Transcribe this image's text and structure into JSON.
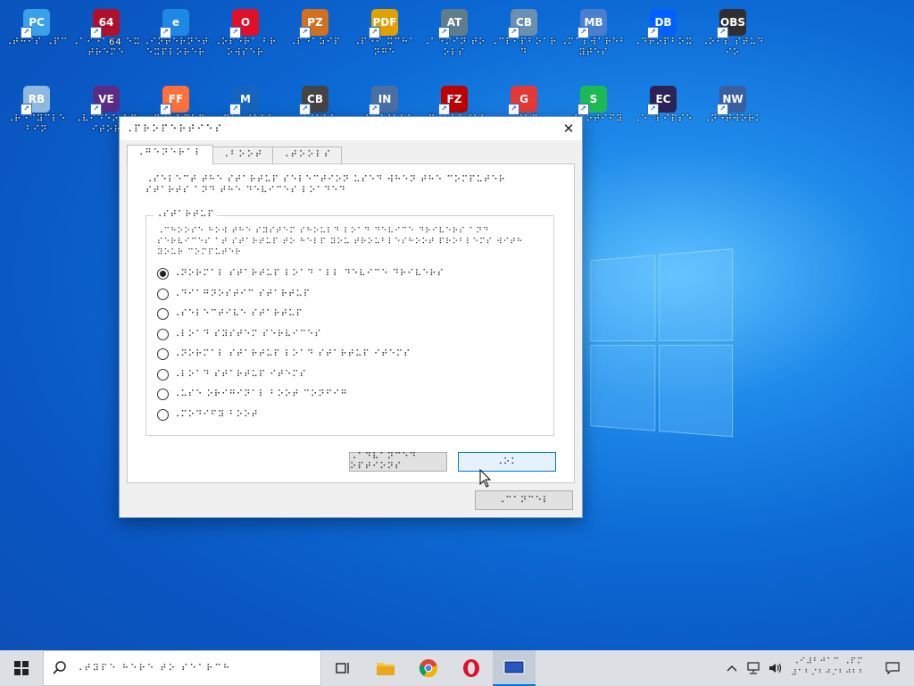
{
  "desktop_icons": [
    {
      "label": "⠠⠞⠓⠊⠎ ⠠⠏⠉",
      "color": "#3aa0e8",
      "glyph": "PC"
    },
    {
      "label": "⠠⠁⠊⠙⠁64 ⠑⠭⠞⠗⠑⠍⠑",
      "color": "#b0102a",
      "glyph": "64"
    },
    {
      "label": "⠠⠊⠝⠞⠑⠗⠝⠑⠞ ⠑⠭⠏⠇⠕⠗⠑⠗",
      "color": "#1e88e5",
      "glyph": "e"
    },
    {
      "label": "⠠⠕⠏⠑⠗⠁ ⠃⠗⠕⠺⠎⠑⠗",
      "color": "#e0102a",
      "glyph": "O"
    },
    {
      "label": "⠠⠏⠑⠁⠵⠊⠏",
      "color": "#d07020",
      "glyph": "PZ"
    },
    {
      "label": "⠠⠏⠙⠋ ⠭⠉⠓⠁⠝⠛⠑",
      "color": "#e0a000",
      "glyph": "PDF"
    },
    {
      "label": "⠠⠁⠙⠍⠊⠝ ⠞⠕⠕⠇⠎",
      "color": "#607d8b",
      "glyph": "AT"
    },
    {
      "label": "⠠⠉⠇⠊⠏⠃⠕⠁⠗⠙",
      "color": "#6a8fb0",
      "glyph": "CB"
    },
    {
      "label": "⠠⠍⠁⠇⠺⠁⠗⠑⠃⠽⠞⠑⠎",
      "color": "#4a7fd0",
      "glyph": "MB"
    },
    {
      "label": "⠠⠙⠗⠕⠏⠃⠕⠭",
      "color": "#0061fe",
      "glyph": "DB"
    },
    {
      "label": "⠠⠕⠃⠎ ⠎⠞⠥⠙⠊⠕",
      "color": "#302e31",
      "glyph": "OBS"
    },
    {
      "label": "⠠⠗⠑⠉⠽⠉⠇⠑ ⠃⠊⠝",
      "color": "#8fb8e0",
      "glyph": "RB"
    },
    {
      "label": "⠠⠧⠊⠙⠑⠕ ⠑⠙⠊⠞⠕⠗",
      "color": "#5b2c86",
      "glyph": "VE"
    },
    {
      "label": "⠠⠋⠊⠗⠑⠋⠕⠭",
      "color": "#ff7139",
      "glyph": "FF"
    },
    {
      "label": "⠠⠍⠁⠇⠺⠁⠗⠑",
      "color": "#1565c0",
      "glyph": "M"
    },
    {
      "label": "⠠⠉⠊⠃⠗⠁",
      "color": "#444444",
      "glyph": "CB"
    },
    {
      "label": "⠠⠊⠝⠎⠞⠁⠇⠇",
      "color": "#4a6fa5",
      "glyph": "IN"
    },
    {
      "label": "⠠⠋⠊⠇⠑⠵⠊⠇⠇⠁",
      "color": "#bf0000",
      "glyph": "FZ"
    },
    {
      "label": "⠠⠛⠕⠍",
      "color": "#e53935",
      "glyph": "G"
    },
    {
      "label": "⠠⠎⠏⠕⠞⠊⠋⠽",
      "color": "#1db954",
      "glyph": "S"
    },
    {
      "label": "⠠⠑⠉⠇⠊⠏⠎⠑",
      "color": "#2c2255",
      "glyph": "EC"
    },
    {
      "label": "⠠⠝⠑⠞⠺⠕⠗⠅",
      "color": "#3a5fa0",
      "glyph": "NW"
    }
  ],
  "dialog": {
    "title": "⠠⠏⠗⠕⠏⠑⠗⠞⠊⠑⠎",
    "close_glyph": "✕",
    "tabs": [
      "⠠⠛⠑⠝⠑⠗⠁⠇",
      "⠠⠃⠕⠕⠞",
      "⠠⠞⠕⠕⠇⠎"
    ],
    "intro_text": "⠠⠎⠑⠇⠑⠉⠞ ⠞⠓⠑ ⠎⠞⠁⠗⠞⠥⠏ ⠎⠑⠇⠑⠉⠞⠊⠕⠝ ⠥⠎⠑⠙ ⠺⠓⠑⠝ ⠞⠓⠑ ⠉⠕⠍⠏⠥⠞⠑⠗ ⠎⠞⠁⠗⠞⠎ ⠁⠝⠙ ⠞⠓⠑ ⠙⠑⠧⠊⠉⠑⠎ ⠇⠕⠁⠙⠑⠙",
    "group_label": "⠠⠎⠞⠁⠗⠞⠥⠏",
    "group_description": "⠠⠉⠓⠕⠕⠎⠑ ⠓⠕⠺ ⠞⠓⠑ ⠎⠽⠎⠞⠑⠍ ⠎⠓⠕⠥⠇⠙ ⠇⠕⠁⠙ ⠙⠑⠧⠊⠉⠑ ⠙⠗⠊⠧⠑⠗⠎ ⠁⠝⠙ ⠎⠑⠗⠧⠊⠉⠑⠎ ⠁⠞ ⠎⠞⠁⠗⠞⠥⠏ ⠞⠕ ⠓⠑⠇⠏ ⠽⠕⠥ ⠞⠗⠕⠥⠃⠇⠑⠎⠓⠕⠕⠞ ⠏⠗⠕⠃⠇⠑⠍⠎ ⠺⠊⠞⠓ ⠽⠕⠥⠗ ⠉⠕⠍⠏⠥⠞⠑⠗",
    "radio_options": [
      "⠠⠝⠕⠗⠍⠁⠇ ⠎⠞⠁⠗⠞⠥⠏ ⠇⠕⠁⠙ ⠁⠇⠇ ⠙⠑⠧⠊⠉⠑ ⠙⠗⠊⠧⠑⠗⠎",
      "⠠⠙⠊⠁⠛⠝⠕⠎⠞⠊⠉ ⠎⠞⠁⠗⠞⠥⠏",
      "⠠⠎⠑⠇⠑⠉⠞⠊⠧⠑ ⠎⠞⠁⠗⠞⠥⠏",
      "⠠⠇⠕⠁⠙ ⠎⠽⠎⠞⠑⠍ ⠎⠑⠗⠧⠊⠉⠑⠎",
      "⠠⠝⠕⠗⠍⠁⠇ ⠎⠞⠁⠗⠞⠥⠏ ⠇⠕⠁⠙ ⠎⠞⠁⠗⠞⠥⠏ ⠊⠞⠑⠍⠎",
      "⠠⠇⠕⠁⠙ ⠎⠞⠁⠗⠞⠥⠏ ⠊⠞⠑⠍⠎",
      "⠠⠥⠎⠑ ⠕⠗⠊⠛⠊⠝⠁⠇ ⠃⠕⠕⠞ ⠉⠕⠝⠋⠊⠛",
      "⠠⠍⠕⠙⠊⠋⠽ ⠃⠕⠕⠞"
    ],
    "selected_index": 0,
    "buttons": {
      "secondary": "⠠⠁⠙⠧⠁⠝⠉⠑⠙ ⠕⠏⠞⠊⠕⠝⠎",
      "primary": "⠠⠕⠅",
      "bottom": "⠠⠉⠁⠝⠉⠑⠇"
    }
  },
  "taskbar": {
    "search_placeholder": "⠠⠞⠽⠏⠑ ⠓⠑⠗⠑ ⠞⠕ ⠎⠑⠁⠗⠉⠓",
    "clock_time": "⠠⠊⠼⠃⠚⠁⠉ ⠠⠏⠍",
    "clock_date": "⠼⠁⠃⠌⠃⠚⠌⠃⠚⠃⠃",
    "tray_icons": [
      "chevron-up-icon",
      "network-icon",
      "volume-icon"
    ]
  },
  "colors": {
    "accent": "#0078d7",
    "taskbar": "#dcdfe3"
  }
}
